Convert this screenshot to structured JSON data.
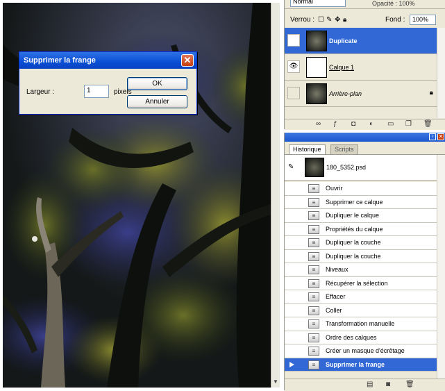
{
  "dialog": {
    "title": "Supprimer la frange",
    "width_label": "Largeur :",
    "width_value": "1",
    "unit": "pixels",
    "ok": "OK",
    "cancel": "Annuler",
    "close_glyph": "✕"
  },
  "layers_panel": {
    "blend_mode": "Normal",
    "opacity_label": "Opacité : 100%",
    "lock_label": "Verrou :",
    "fill_label": "Fond :",
    "fill_value": "100%",
    "layers": [
      {
        "name": "Duplicate",
        "visible": true,
        "selected": true
      },
      {
        "name": "Calque 1",
        "visible": true,
        "selected": false
      },
      {
        "name": "Arrière-plan",
        "visible": false,
        "selected": false,
        "locked": true
      }
    ]
  },
  "history_panel": {
    "tabs": [
      "Historique",
      "Scripts"
    ],
    "snapshot": "180_5352.psd",
    "steps": [
      "Ouvrir",
      "Supprimer ce calque",
      "Dupliquer le calque",
      "Propriétés du calque",
      "Dupliquer la couche",
      "Dupliquer la couche",
      "Niveaux",
      "Récupérer la sélection",
      "Effacer",
      "Coller",
      "Transformation manuelle",
      "Ordre des calques",
      "Créer un masque d'écrêtage",
      "Supprimer la frange"
    ],
    "current_step": 13
  },
  "colors": {
    "selection": "#3168d5",
    "titlebar": "#0a4fd5",
    "panel_bg": "#ece9d8",
    "close_button": "#c8400f"
  }
}
